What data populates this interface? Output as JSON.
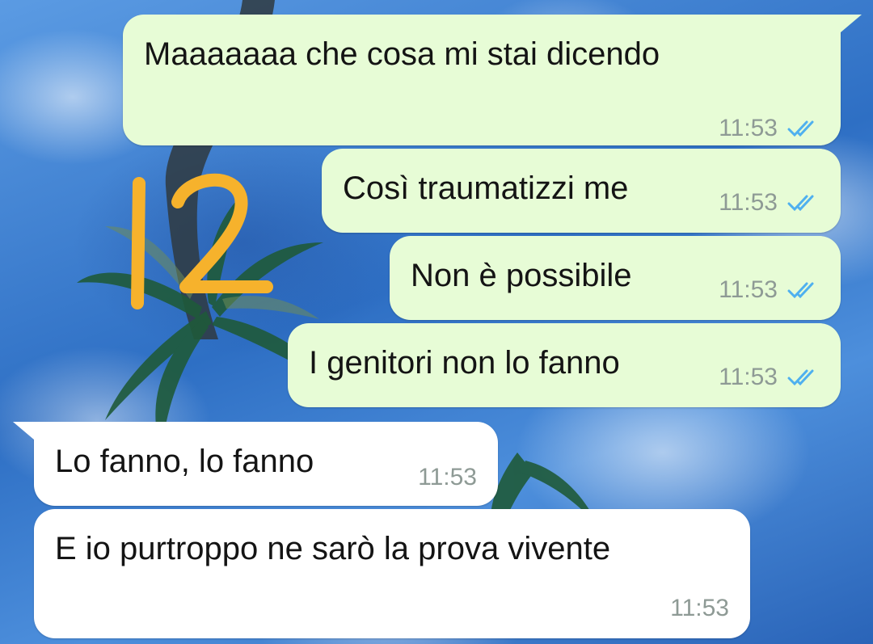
{
  "messages": [
    {
      "text": "Maaaaaaa che cosa mi stai dicendo",
      "time": "11:53",
      "direction": "outgoing",
      "status": "read-double-tick"
    },
    {
      "text": "Così traumatizzi me",
      "time": "11:53",
      "direction": "outgoing",
      "status": "read-double-tick"
    },
    {
      "text": "Non è possibile",
      "time": "11:53",
      "direction": "outgoing",
      "status": "read-double-tick"
    },
    {
      "text": "I genitori non lo fanno",
      "time": "11:53",
      "direction": "outgoing",
      "status": "read-double-tick"
    },
    {
      "text": "Lo fanno, lo fanno",
      "time": "11:53",
      "direction": "incoming"
    },
    {
      "text": "E io purtroppo ne sarò la prova vivente",
      "time": "11:53",
      "direction": "incoming"
    }
  ],
  "overlay": {
    "handwritten_number": "12",
    "color": "#f6b22c"
  },
  "colors": {
    "outgoing_bubble": "#e7fcd6",
    "incoming_bubble": "#ffffff",
    "read_tick": "#4fb0ef",
    "timestamp": "#8e9a95"
  },
  "icons": {
    "read_receipt": "double-check-icon"
  }
}
